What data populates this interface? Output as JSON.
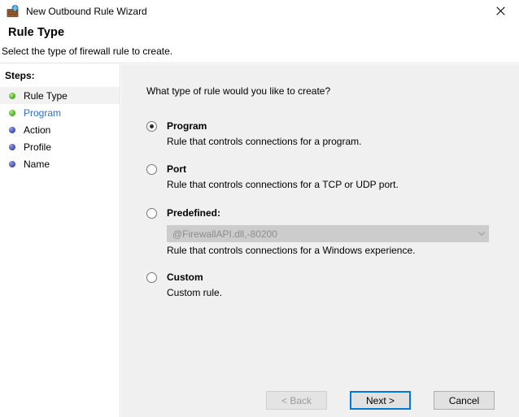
{
  "window": {
    "title": "New Outbound Rule Wizard",
    "icon": "firewall-wall-globe-icon",
    "close_label": "✕"
  },
  "header": {
    "title": "Rule Type",
    "subtitle": "Select the type of firewall rule to create."
  },
  "sidebar": {
    "label": "Steps:",
    "items": [
      {
        "label": "Rule Type",
        "state": "current",
        "bullet_color": "#5fbb33",
        "is_link": false
      },
      {
        "label": "Program",
        "state": "done",
        "bullet_color": "#5fbb33",
        "is_link": true
      },
      {
        "label": "Action",
        "state": "pending",
        "bullet_color": "#4755b4",
        "is_link": false
      },
      {
        "label": "Profile",
        "state": "pending",
        "bullet_color": "#4755b4",
        "is_link": false
      },
      {
        "label": "Name",
        "state": "pending",
        "bullet_color": "#4755b4",
        "is_link": false
      }
    ]
  },
  "main": {
    "question": "What type of rule would you like to create?",
    "options": [
      {
        "id": "program",
        "label": "Program",
        "description": "Rule that controls connections for a program.",
        "selected": true
      },
      {
        "id": "port",
        "label": "Port",
        "description": "Rule that controls connections for a TCP or UDP port.",
        "selected": false
      },
      {
        "id": "predefined",
        "label": "Predefined:",
        "description": "Rule that controls connections for a Windows experience.",
        "selected": false,
        "combo_value": "@FirewallAPI.dll,-80200",
        "combo_disabled": true
      },
      {
        "id": "custom",
        "label": "Custom",
        "description": "Custom rule.",
        "selected": false
      }
    ]
  },
  "footer": {
    "back_label": "< Back",
    "back_disabled": true,
    "next_label": "Next >",
    "next_focused": true,
    "cancel_label": "Cancel"
  },
  "colors": {
    "accent": "#0078d7",
    "link": "#2a6ed8",
    "panel_bg": "#f0f0f0",
    "sidebar_bg": "#ffffff",
    "step_done": "#5fbb33",
    "step_pending": "#4755b4",
    "disabled_text": "#8d8d8d"
  }
}
